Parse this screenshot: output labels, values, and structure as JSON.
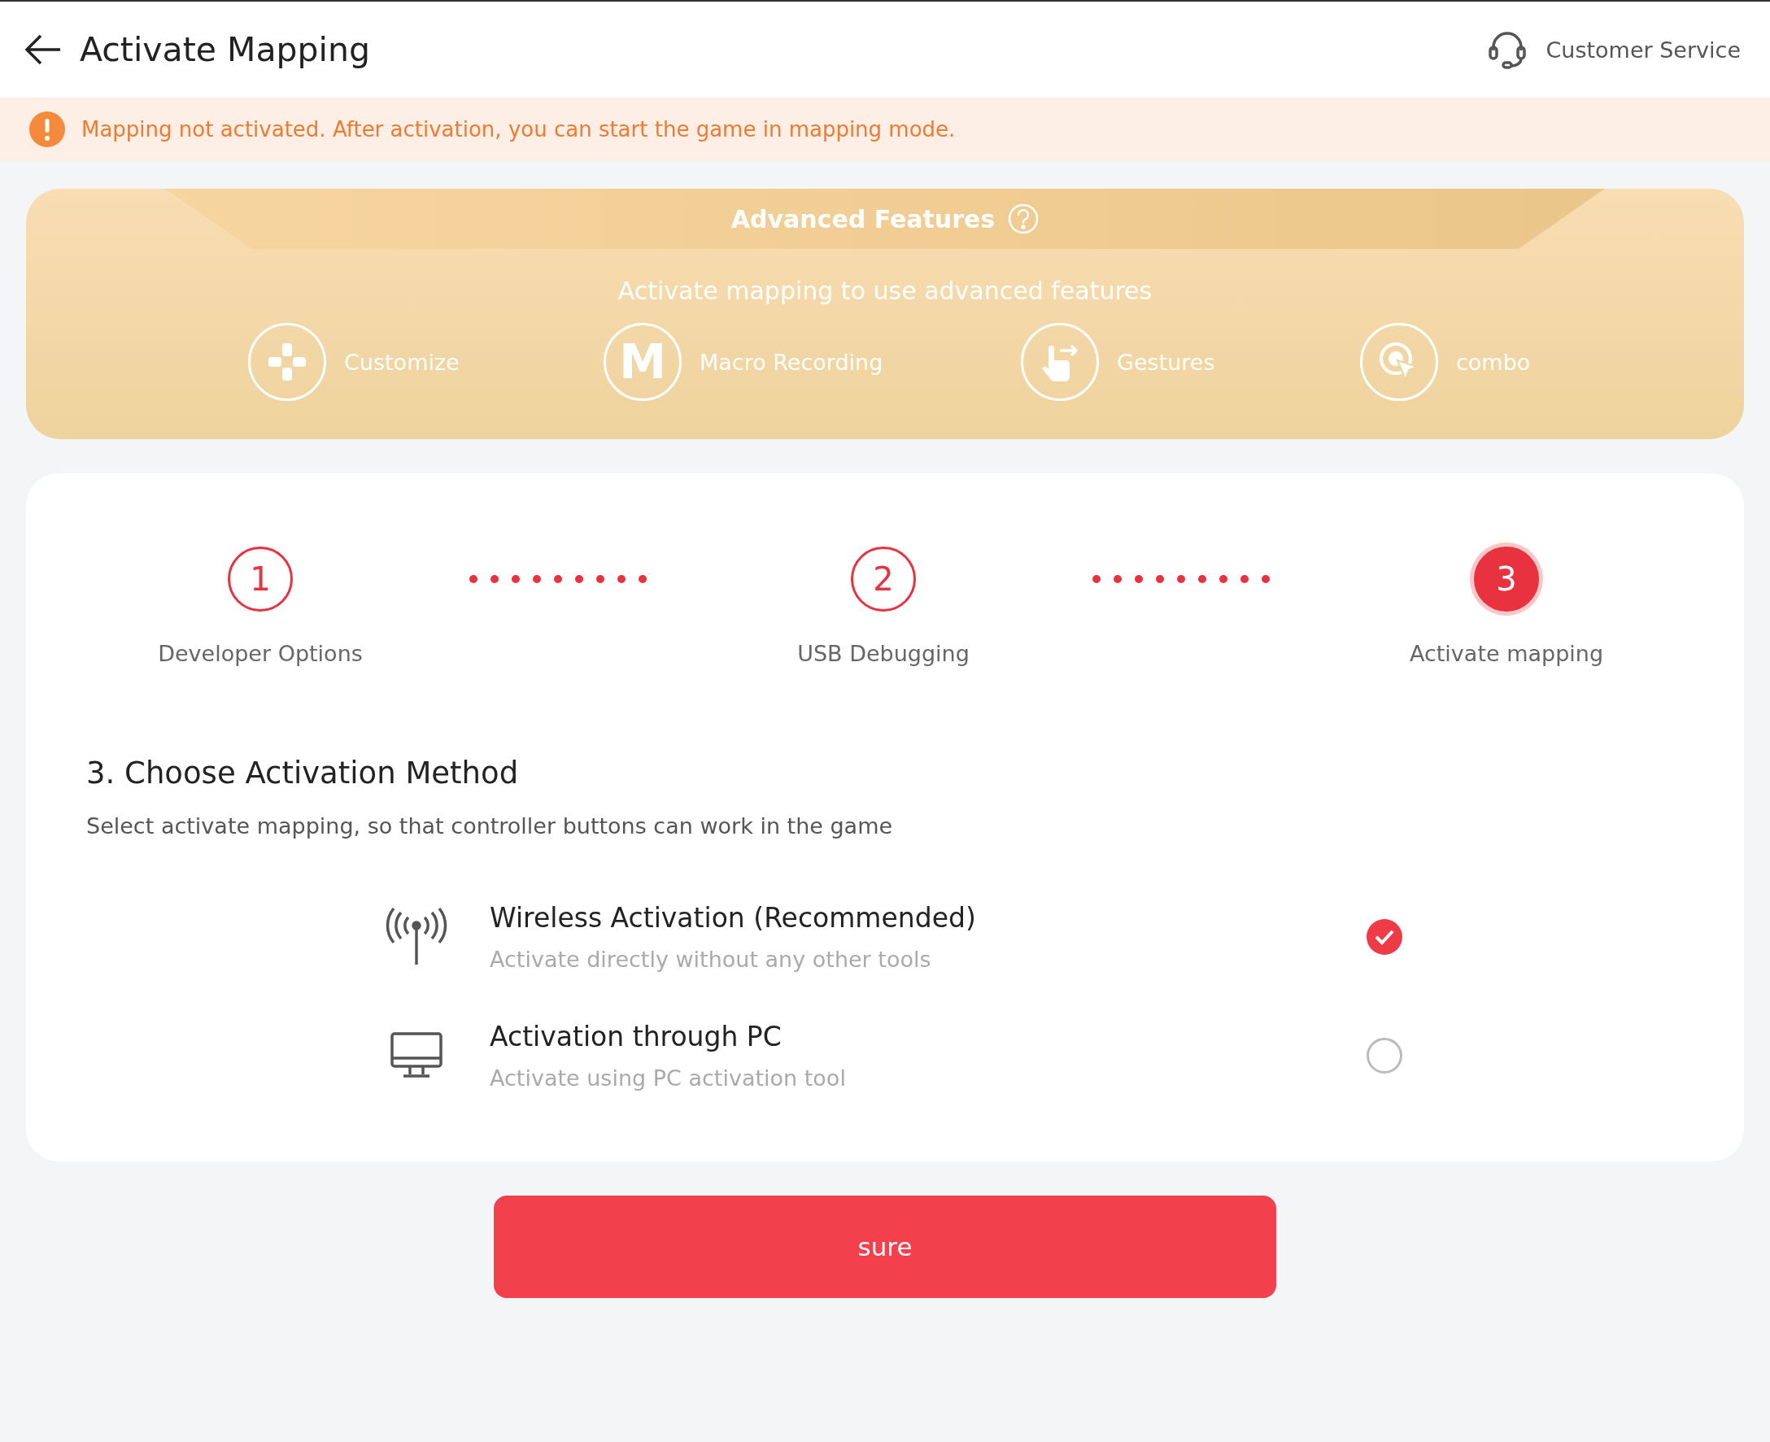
{
  "header": {
    "title": "Activate Mapping",
    "service": "Customer Service"
  },
  "notice": {
    "text": "Mapping not activated. After activation, you can start the game in mapping mode."
  },
  "advanced": {
    "title": "Advanced Features",
    "subtitle": "Activate mapping to use advanced features",
    "features": [
      {
        "kind": "gamepad",
        "label": "Customize"
      },
      {
        "kind": "letter",
        "glyph": "M",
        "label": "Macro Recording"
      },
      {
        "kind": "gesture",
        "label": "Gestures"
      },
      {
        "kind": "target",
        "label": "combo"
      }
    ]
  },
  "steps": [
    {
      "number": "1",
      "label": "Developer Options",
      "selected": false
    },
    {
      "number": "2",
      "label": "USB Debugging",
      "selected": false
    },
    {
      "number": "3",
      "label": "Activate mapping",
      "selected": true
    }
  ],
  "method": {
    "title": "3. Choose Activation Method",
    "description": "Select activate mapping, so that controller buttons can work in the game",
    "options": [
      {
        "kind": "wireless",
        "title": "Wireless Activation (Recommended)",
        "subtitle": "Activate directly without any other tools",
        "selected": true
      },
      {
        "kind": "pc",
        "title": "Activation through PC",
        "subtitle": "Activate using PC activation tool",
        "selected": false
      }
    ]
  },
  "confirm": {
    "label": "sure"
  }
}
